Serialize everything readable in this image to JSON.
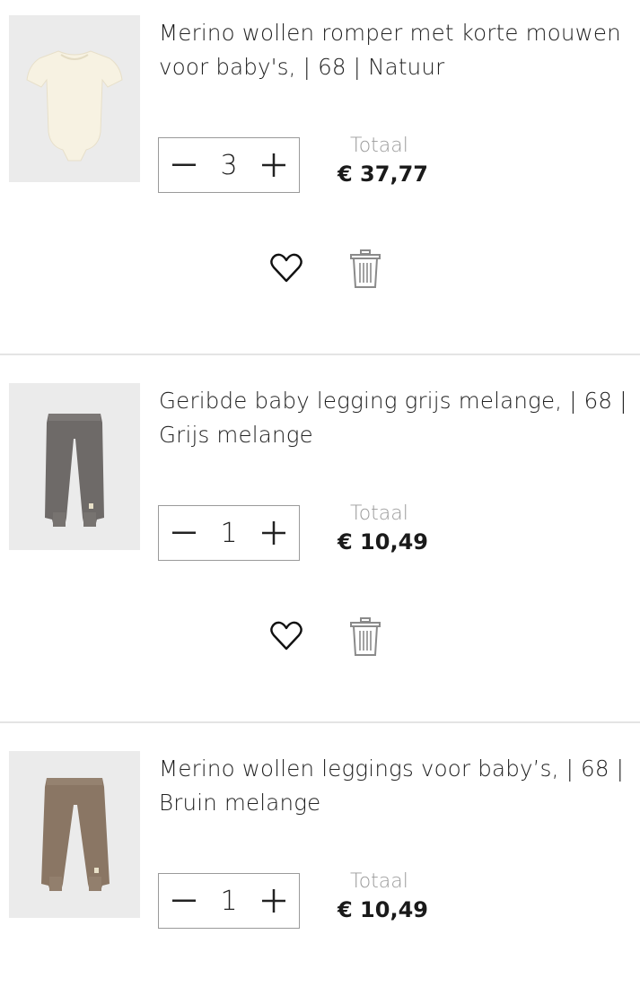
{
  "cart": {
    "total_label": "Totaal",
    "items": [
      {
        "title": "Merino wollen romper met korte mouwen voor baby's, | 68 | Natuur",
        "quantity": "3",
        "total": "€ 37,77",
        "image_icon": "romper-image"
      },
      {
        "title": "Geribde baby legging grijs melange, | 68 | Grijs melange",
        "quantity": "1",
        "total": "€ 10,49",
        "image_icon": "legging-grey-image"
      },
      {
        "title": "Merino wollen leggings voor baby’s, | 68 | Bruin melange",
        "quantity": "1",
        "total": "€ 10,49",
        "image_icon": "legging-brown-image"
      }
    ]
  },
  "icons": {
    "minus": "minus-icon",
    "plus": "plus-icon",
    "wishlist": "heart-icon",
    "delete": "trash-icon"
  },
  "colors": {
    "border": "#9a9a9a",
    "muted_text": "#9b9b9b",
    "divider": "#e4e4e4",
    "thumb_bg": "#ececec"
  }
}
